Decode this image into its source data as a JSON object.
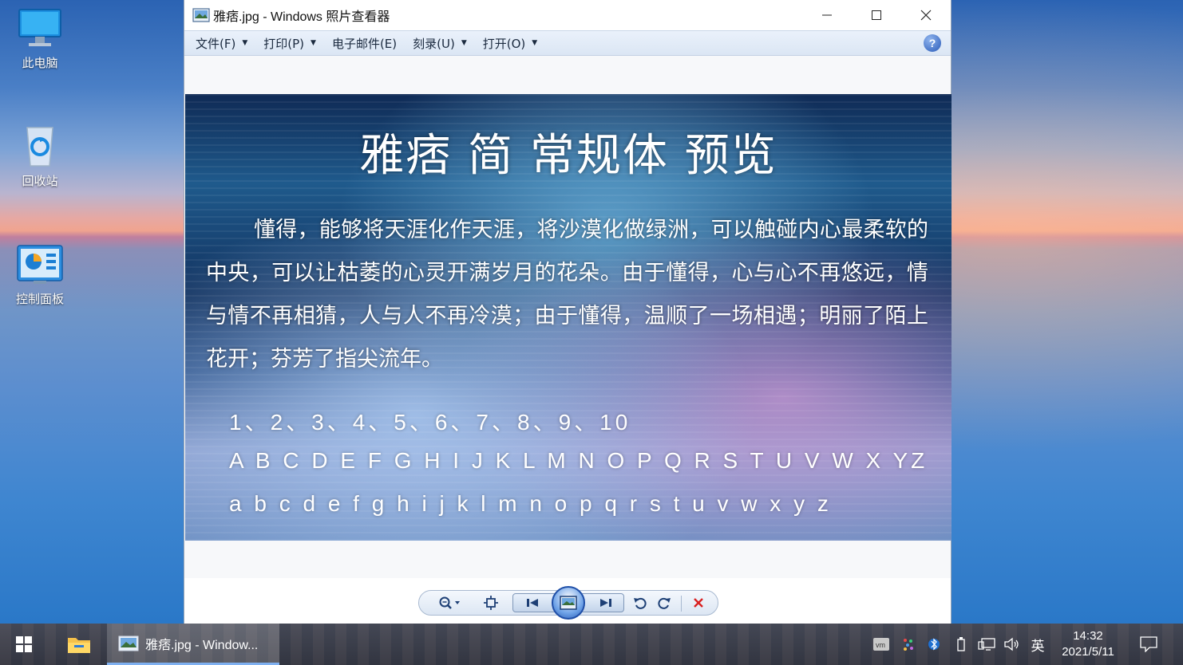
{
  "desktop": {
    "icons": [
      {
        "label": "此电脑",
        "icon": "computer-icon"
      },
      {
        "label": "回收站",
        "icon": "recycle-bin-icon"
      },
      {
        "label": "控制面板",
        "icon": "control-panel-icon"
      }
    ]
  },
  "window": {
    "title": "雅痞.jpg - Windows 照片查看器",
    "app_icon": "photo-viewer-icon",
    "menu": [
      {
        "label": "文件(F)",
        "has_dropdown": true
      },
      {
        "label": "打印(P)",
        "has_dropdown": true
      },
      {
        "label": "电子邮件(E)",
        "has_dropdown": false
      },
      {
        "label": "刻录(U)",
        "has_dropdown": true
      },
      {
        "label": "打开(O)",
        "has_dropdown": true
      }
    ],
    "help_label": "?"
  },
  "photo": {
    "title": "雅痞 简 常规体 预览",
    "paragraph": "懂得，能够将天涯化作天涯，将沙漠化做绿洲，可以触碰内心最柔软的中央，可以让枯萎的心灵开满岁月的花朵。由于懂得，心与心不再悠远，情与情不再相猜，人与人不再冷漠；由于懂得，温顺了一场相遇；明丽了陌上花开；芬芳了指尖流年。",
    "numbers": "1、2、3、4、5、6、7、8、9、10",
    "uppercase": "A B C D E F G H I J K L M N O P Q R S T U V W X YZ",
    "lowercase": "a b c d e f g h i j k l m n o p q r s t u v w x y z"
  },
  "controls": {
    "zoom": "zoom-icon",
    "actual_size": "actual-size-icon",
    "previous": "previous-icon",
    "slideshow": "slideshow-icon",
    "next": "next-icon",
    "rotate_left": "rotate-counterclockwise-icon",
    "rotate_right": "rotate-clockwise-icon",
    "delete": "delete-icon"
  },
  "taskbar": {
    "task_label": "雅痞.jpg - Window...",
    "ime": "英",
    "time": "14:32",
    "date": "2021/5/11"
  },
  "colors": {
    "menubar": "#dbe6f4",
    "delete_red": "#d92020",
    "accent_blue": "#2a5cb5"
  }
}
